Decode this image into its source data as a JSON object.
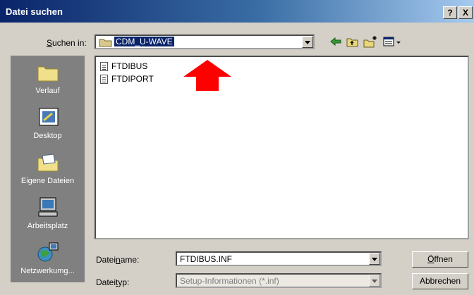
{
  "window": {
    "title": "Datei suchen",
    "help": "?",
    "close": "X"
  },
  "lookin": {
    "label_pre": "",
    "label_ul": "S",
    "label_post": "uchen in:",
    "value": "CDM_U-WAVE"
  },
  "places": [
    {
      "label": "Verlauf",
      "icon": "history-folder-icon"
    },
    {
      "label": "Desktop",
      "icon": "desktop-icon"
    },
    {
      "label": "Eigene Dateien",
      "icon": "my-documents-icon"
    },
    {
      "label": "Arbeitsplatz",
      "icon": "my-computer-icon"
    },
    {
      "label": "Netzwerkumg...",
      "icon": "network-icon"
    }
  ],
  "files": [
    {
      "name": "FTDIBUS",
      "icon": "setup-file-icon"
    },
    {
      "name": "FTDIPORT",
      "icon": "setup-file-icon"
    }
  ],
  "filename": {
    "label_pre": "Datei",
    "label_ul": "n",
    "label_post": "ame:",
    "value": "FTDIBUS.INF"
  },
  "filetype": {
    "label_pre": "Datei",
    "label_ul": "t",
    "label_post": "yp:",
    "value": "Setup-Informationen (*.inf)"
  },
  "buttons": {
    "open_ul": "Ö",
    "open_post": "ffnen",
    "cancel": "Abbrechen"
  },
  "colors": {
    "titlebar": "#0a246a",
    "accent_arrow": "#ff0000",
    "selection": "#0a246a"
  }
}
